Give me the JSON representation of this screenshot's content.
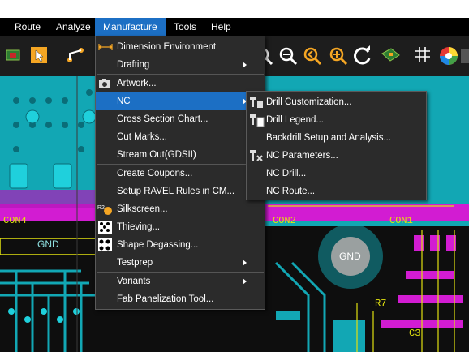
{
  "menubar": {
    "items": [
      {
        "label": "Route"
      },
      {
        "label": "Analyze"
      },
      {
        "label": "Manufacture"
      },
      {
        "label": "Tools"
      },
      {
        "label": "Help"
      }
    ]
  },
  "manufacture_menu": {
    "items": [
      {
        "label": "Dimension Environment",
        "icon": "dimension-icon"
      },
      {
        "label": "Drafting",
        "submenu": true
      },
      {
        "label": "Artwork...",
        "icon": "camera-icon"
      },
      {
        "label": "NC",
        "submenu": true,
        "selected": true
      },
      {
        "label": "Cross Section Chart..."
      },
      {
        "label": "Cut Marks..."
      },
      {
        "label": "Stream Out(GDSII)"
      },
      {
        "label": "Create Coupons..."
      },
      {
        "label": "Setup RAVEL Rules in CM..."
      },
      {
        "label": "Silkscreen...",
        "icon": "silkscreen-icon"
      },
      {
        "label": "Thieving...",
        "icon": "thieving-icon"
      },
      {
        "label": "Shape Degassing...",
        "icon": "degassing-icon"
      },
      {
        "label": "Testprep",
        "submenu": true
      },
      {
        "label": "Variants",
        "submenu": true
      },
      {
        "label": "Fab Panelization Tool..."
      }
    ]
  },
  "nc_submenu": {
    "items": [
      {
        "label": "Drill Customization...",
        "icon": "drill-customization-icon"
      },
      {
        "label": "Drill Legend...",
        "icon": "drill-legend-icon"
      },
      {
        "label": "Backdrill Setup and Analysis..."
      },
      {
        "label": "NC Parameters...",
        "icon": "nc-parameters-icon"
      },
      {
        "label": "NC Drill..."
      },
      {
        "label": "NC Route..."
      }
    ]
  },
  "board": {
    "labels": [
      "CON4",
      "GND",
      "CON2",
      "CON1",
      "GND",
      "R7",
      "C3",
      "R2"
    ]
  },
  "colors": {
    "accent": "#1c6fc4",
    "menu_bg": "#2b2b2b",
    "copper_cyan": "#14b8c4",
    "magenta": "#d21cd2",
    "trace_yellow": "#e0e010"
  }
}
